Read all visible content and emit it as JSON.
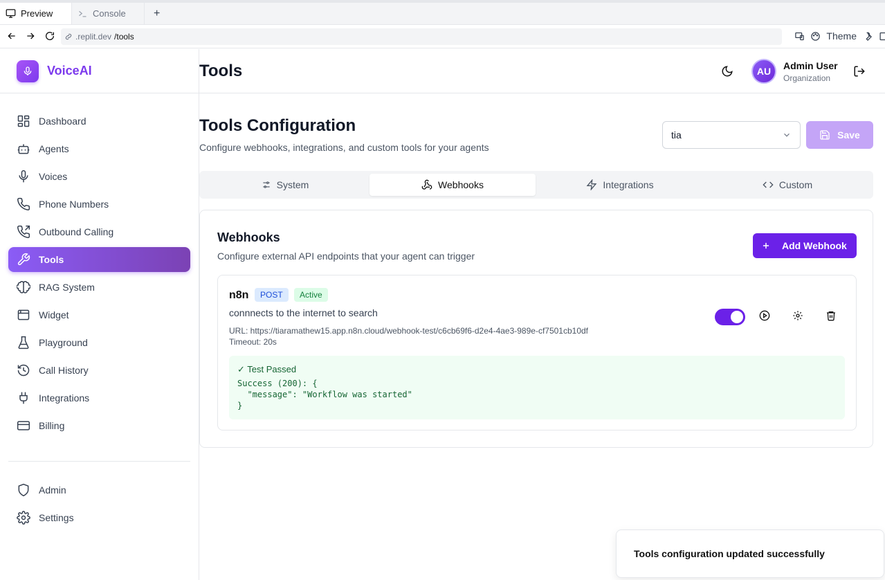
{
  "browser": {
    "tabs": [
      {
        "label": "Preview"
      },
      {
        "label": "Console"
      }
    ],
    "new_tab": "+",
    "url_host": ".replit.dev",
    "url_path": "/tools",
    "theme_label": "Theme"
  },
  "sidebar": {
    "brand": "VoiceAI",
    "items": [
      {
        "label": "Dashboard",
        "icon": "dashboard-icon"
      },
      {
        "label": "Agents",
        "icon": "bot-icon"
      },
      {
        "label": "Voices",
        "icon": "mic-icon"
      },
      {
        "label": "Phone Numbers",
        "icon": "phone-icon"
      },
      {
        "label": "Outbound Calling",
        "icon": "phone-outgoing-icon"
      },
      {
        "label": "Tools",
        "icon": "wrench-icon",
        "active": true
      },
      {
        "label": "RAG System",
        "icon": "brain-icon"
      },
      {
        "label": "Widget",
        "icon": "widget-icon"
      },
      {
        "label": "Playground",
        "icon": "flask-icon"
      },
      {
        "label": "Call History",
        "icon": "history-icon"
      },
      {
        "label": "Integrations",
        "icon": "plug-icon"
      },
      {
        "label": "Billing",
        "icon": "card-icon"
      }
    ],
    "bottom_items": [
      {
        "label": "Admin",
        "icon": "shield-icon"
      },
      {
        "label": "Settings",
        "icon": "gear-icon"
      }
    ]
  },
  "header": {
    "title": "Tools",
    "user": {
      "initials": "AU",
      "name": "Admin User",
      "org": "Organization"
    }
  },
  "main": {
    "title": "Tools Configuration",
    "subtitle": "Configure webhooks, integrations, and custom tools for your agents",
    "agent_select": "tia",
    "save_label": "Save",
    "tabs": [
      {
        "label": "System"
      },
      {
        "label": "Webhooks",
        "active": true
      },
      {
        "label": "Integrations"
      },
      {
        "label": "Custom"
      }
    ]
  },
  "webhooks": {
    "title": "Webhooks",
    "subtitle": "Configure external API endpoints that your agent can trigger",
    "add_label": "Add Webhook",
    "item": {
      "name": "n8n",
      "method": "POST",
      "status": "Active",
      "description": "connnects to the internet to search",
      "url": "URL: https://tiaramathew15.app.n8n.cloud/webhook-test/c6cb69f6-d2e4-4ae3-989e-cf7501cb10df",
      "timeout": "Timeout: 20s",
      "enabled": true,
      "test_title": "✓ Test Passed",
      "test_output": "Success (200): {\n  \"message\": \"Workflow was started\"\n}"
    }
  },
  "toast": "Tools configuration updated successfully",
  "colors": {
    "accent": "#6b21e8",
    "brand": "#7c3aed",
    "success_bg": "#f0fdf4",
    "success_text": "#166534"
  }
}
